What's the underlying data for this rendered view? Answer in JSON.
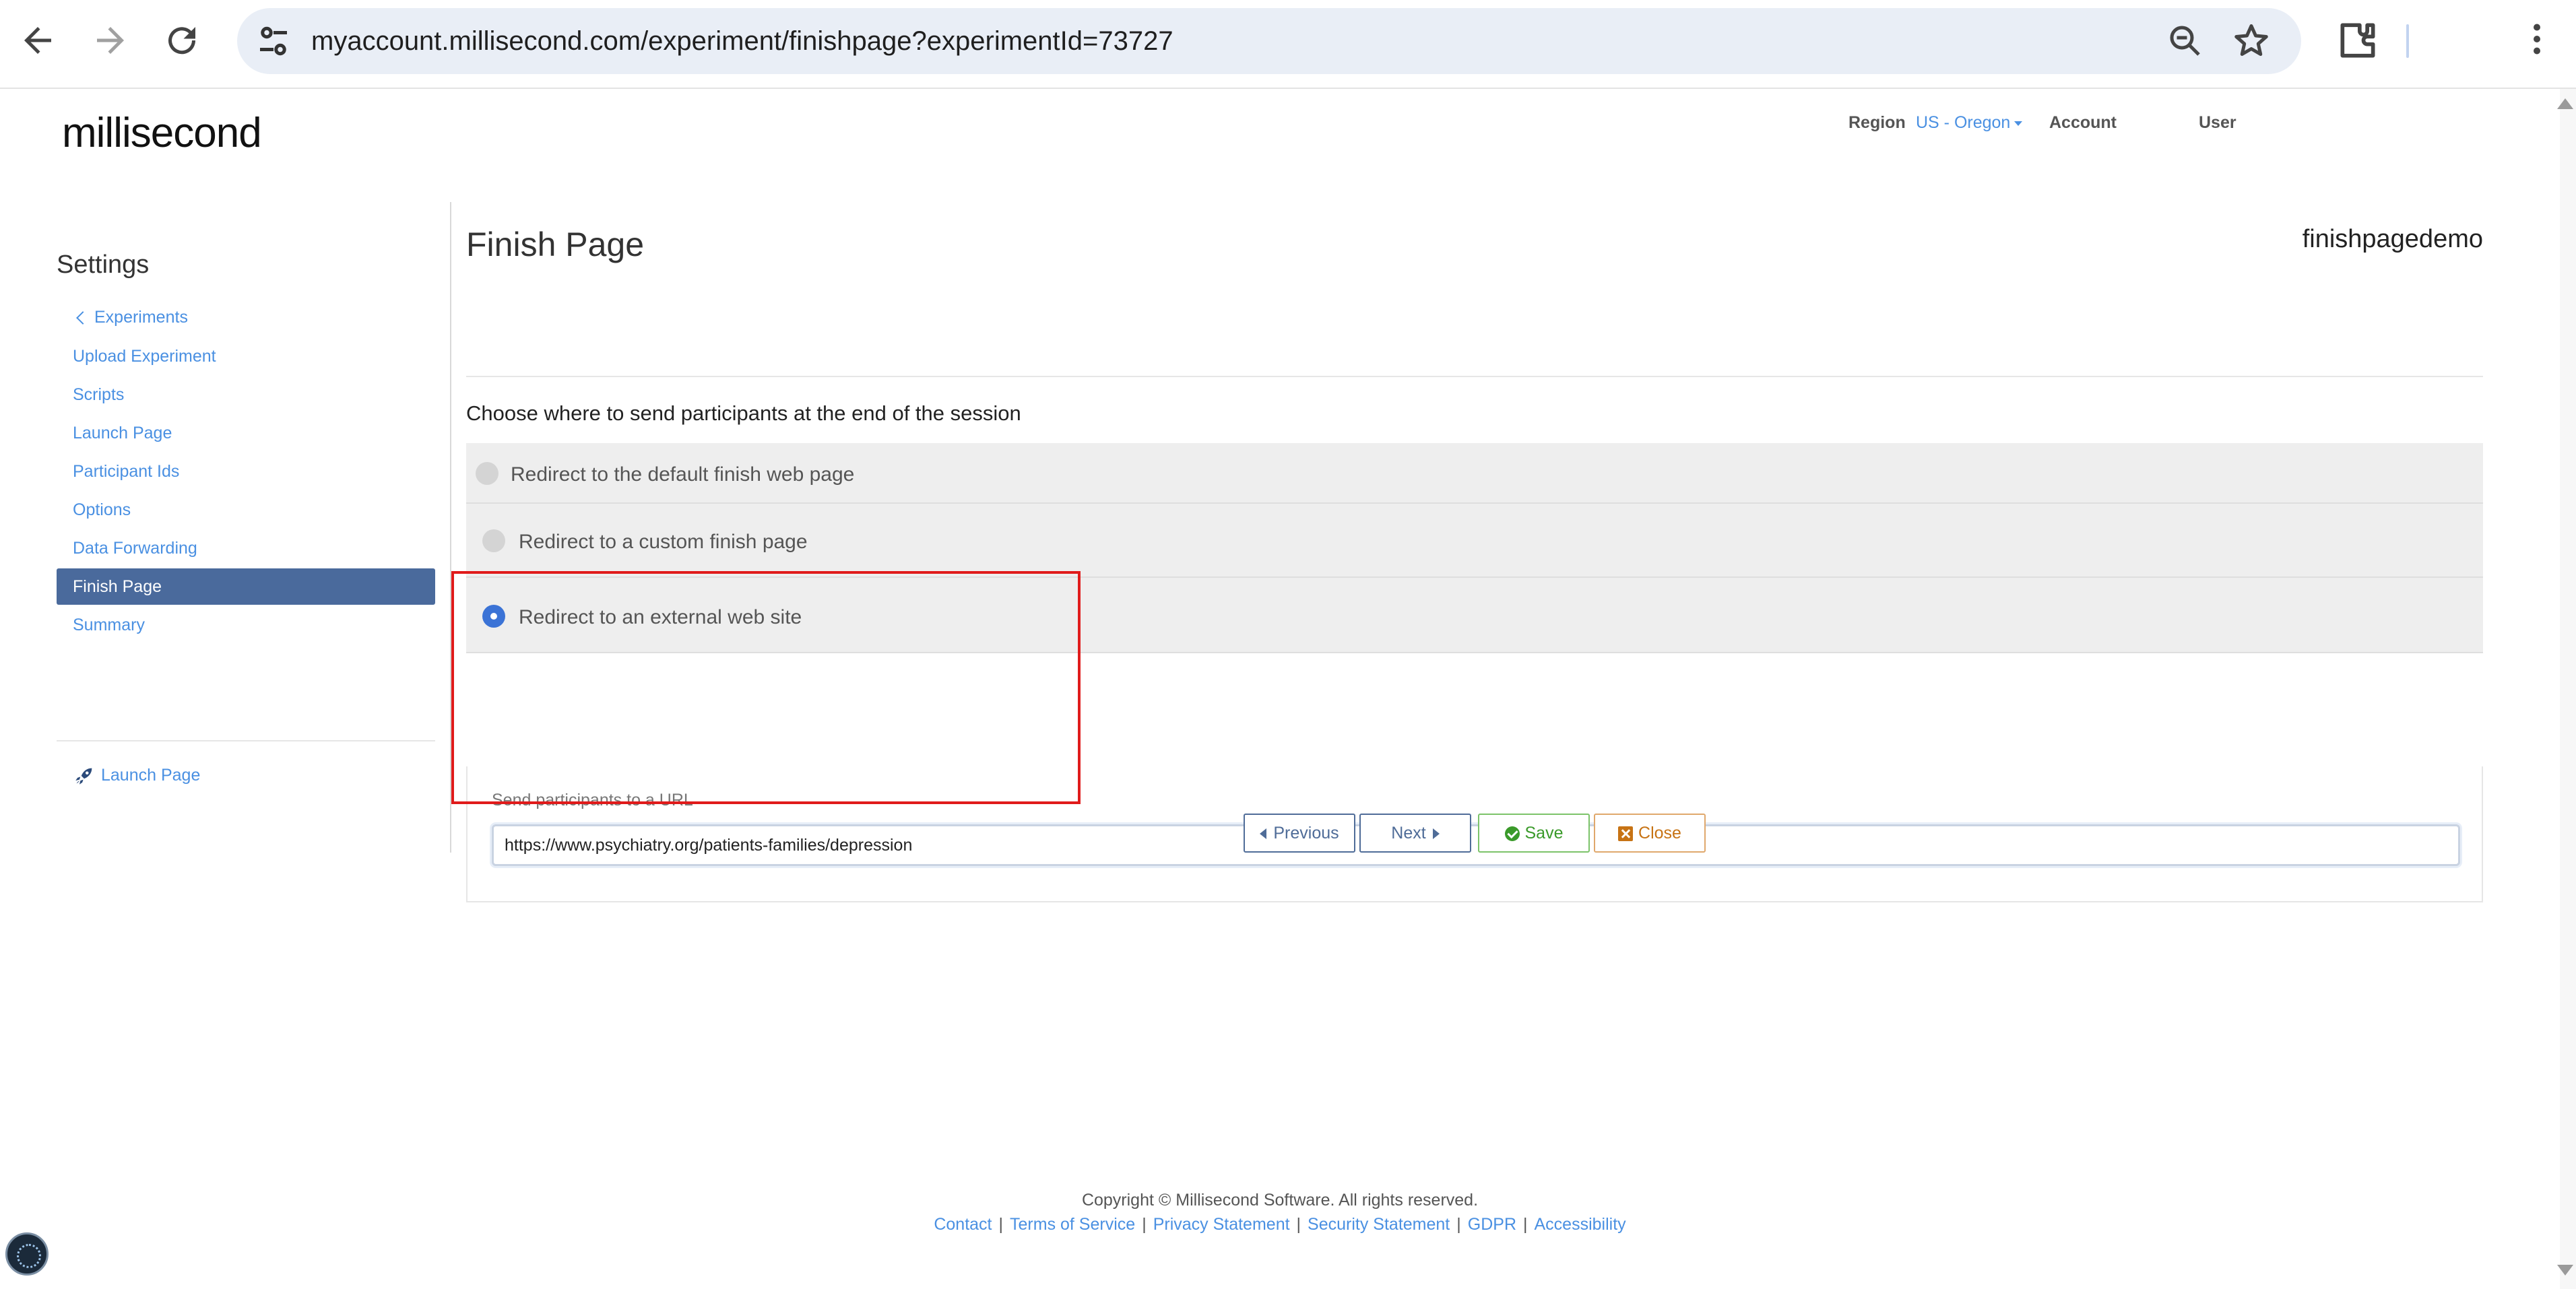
{
  "browser": {
    "url": "myaccount.millisecond.com/experiment/finishpage?experimentId=73727",
    "icons": [
      "back-arrow-icon",
      "forward-arrow-icon",
      "reload-icon",
      "tune-icon",
      "zoom-icon",
      "bookmark-star-icon",
      "extensions-icon",
      "more-menu-icon"
    ]
  },
  "header": {
    "logo": "millisecond",
    "region_label": "Region",
    "region_value": "US - Oregon",
    "account": "Account",
    "user": "User"
  },
  "sidebar": {
    "title": "Settings",
    "back_link": "Experiments",
    "items": [
      {
        "label": "Upload Experiment"
      },
      {
        "label": "Scripts"
      },
      {
        "label": "Launch Page"
      },
      {
        "label": "Participant Ids"
      },
      {
        "label": "Options"
      },
      {
        "label": "Data Forwarding"
      },
      {
        "label": "Finish Page"
      },
      {
        "label": "Summary"
      }
    ],
    "launch_link": "Launch Page"
  },
  "main": {
    "title": "Finish Page",
    "experiment_name": "finishpagedemo",
    "instruction": "Choose where to send participants at the end of the session",
    "options": [
      {
        "label": "Redirect to the default finish web page",
        "selected": false
      },
      {
        "label": "Redirect to a custom finish page",
        "selected": false
      },
      {
        "label": "Redirect to an external web site",
        "selected": true
      }
    ],
    "url_label": "Send participants to a URL",
    "url_value": "https://www.psychiatry.org/patients-families/depression"
  },
  "buttons": {
    "previous": "Previous",
    "next": "Next",
    "save": "Save",
    "close": "Close"
  },
  "footer": {
    "copyright": "Copyright © Millisecond Software. All rights reserved.",
    "links": [
      "Contact",
      "Terms of Service",
      "Privacy Statement",
      "Security Statement",
      "GDPR",
      "Accessibility"
    ]
  },
  "colors": {
    "accent": "#4a90e2",
    "active_nav": "#4a6a9c",
    "highlight": "#e01b1b",
    "save": "#3a9a2a",
    "close": "#c77314"
  }
}
